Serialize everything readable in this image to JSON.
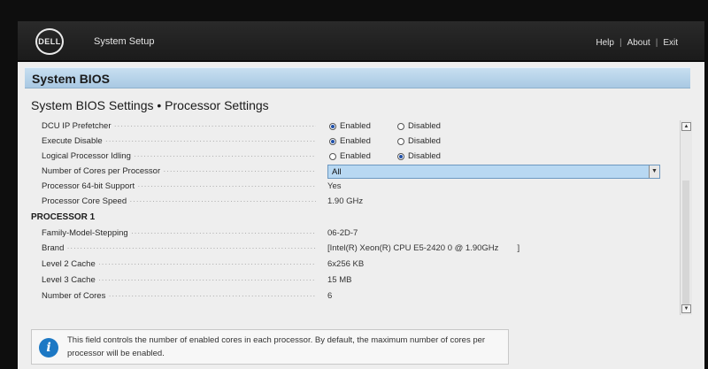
{
  "header": {
    "logo_text": "DELL",
    "app_title": "System Setup",
    "links": [
      "Help",
      "About",
      "Exit"
    ],
    "separator": "|"
  },
  "section": {
    "title": "System BIOS"
  },
  "page_title": "System BIOS Settings • Processor Settings",
  "settings": {
    "dcu_ip_prefetcher": {
      "label": "DCU IP Prefetcher",
      "options": [
        "Enabled",
        "Disabled"
      ],
      "selected": "Enabled"
    },
    "execute_disable": {
      "label": "Execute Disable",
      "options": [
        "Enabled",
        "Disabled"
      ],
      "selected": "Enabled"
    },
    "logical_processor_idling": {
      "label": "Logical Processor Idling",
      "options": [
        "Enabled",
        "Disabled"
      ],
      "selected": "Disabled"
    },
    "cores_per_processor": {
      "label": "Number of Cores per Processor",
      "value": "All"
    },
    "processor_64bit": {
      "label": "Processor 64-bit Support",
      "value": "Yes"
    },
    "processor_core_speed": {
      "label": "Processor Core Speed",
      "value": "1.90 GHz"
    }
  },
  "processor1": {
    "heading": "PROCESSOR 1",
    "family_model_stepping": {
      "label": "Family-Model-Stepping",
      "value": "06-2D-7"
    },
    "brand": {
      "label": "Brand",
      "value": "[Intel(R) Xeon(R) CPU E5-2420 0 @ 1.90GHz        ]"
    },
    "l2_cache": {
      "label": "Level 2 Cache",
      "value": "6x256 KB"
    },
    "l3_cache": {
      "label": "Level 3 Cache",
      "value": "15 MB"
    },
    "num_cores": {
      "label": "Number of Cores",
      "value": "6"
    }
  },
  "help": {
    "icon": "info-icon",
    "text": "This field controls the number of enabled cores in each processor. By default, the maximum number of cores per processor will be enabled."
  },
  "colors": {
    "section_bar": "#a9c9e3",
    "select_highlight": "#b8d8f2",
    "radio_selected": "#1f4fa8",
    "info_icon": "#1c78c4"
  }
}
